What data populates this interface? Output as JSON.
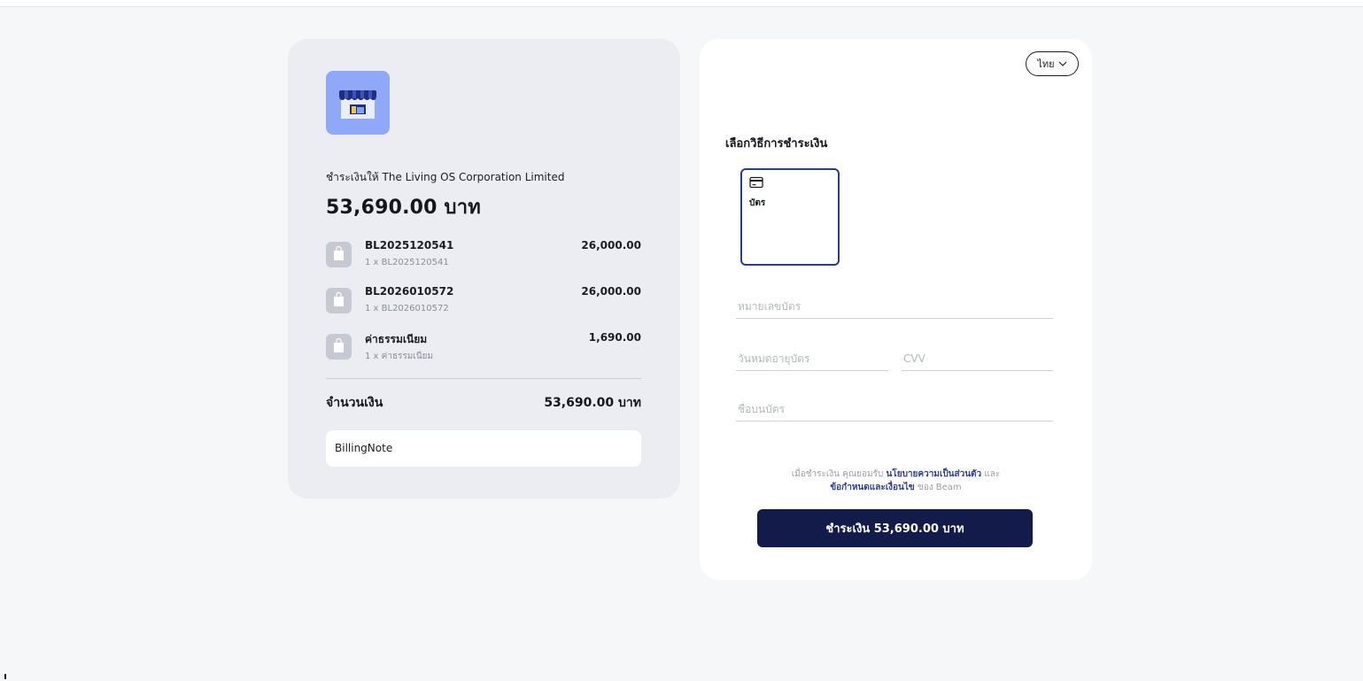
{
  "summary": {
    "pay_to": "ชำระเงินให้ The Living OS Corporation Limited",
    "total": "53,690.00 บาท",
    "items": [
      {
        "name": "BL2025120541",
        "sub": "1 x BL2025120541",
        "price": "26,000.00"
      },
      {
        "name": "BL2026010572",
        "sub": "1 x BL2026010572",
        "price": "26,000.00"
      },
      {
        "name": "ค่าธรรมเนียม",
        "sub": "1 x ค่าธรรมเนียม",
        "price": "1,690.00"
      }
    ],
    "amount_label": "จำนวนเงิน",
    "amount_value": "53,690.00 บาท",
    "note": "BillingNote"
  },
  "payment": {
    "language": "ไทย",
    "section_title": "เลือกวิธีการชำระเงิน",
    "method": {
      "label": "บัตร",
      "icon": "credit-card-icon"
    },
    "fields": {
      "card_number_placeholder": "หมายเลขบัตร",
      "expiry_placeholder": "วันหมดอายุบัตร",
      "cvv_placeholder": "CVV",
      "name_placeholder": "ชื่อบนบัตร"
    },
    "consent": {
      "prefix": "เมื่อชำระเงิน คุณยอมรับ ",
      "privacy_link": "นโยบายความเป็นส่วนตัว",
      "and": " และ",
      "terms_link": "ข้อกำหนดและเงื่อนไข",
      "suffix": " ของ Beam"
    },
    "pay_button": "ชำระเงิน 53,690.00 บาท"
  },
  "colors": {
    "page_bg": "#f6f7f9",
    "summary_card_bg": "#ebedf3",
    "logo_bg": "#8fa8f7",
    "tile_border": "#2e3d8a",
    "link": "#2f3f8f",
    "button_bg": "#121b4a"
  }
}
